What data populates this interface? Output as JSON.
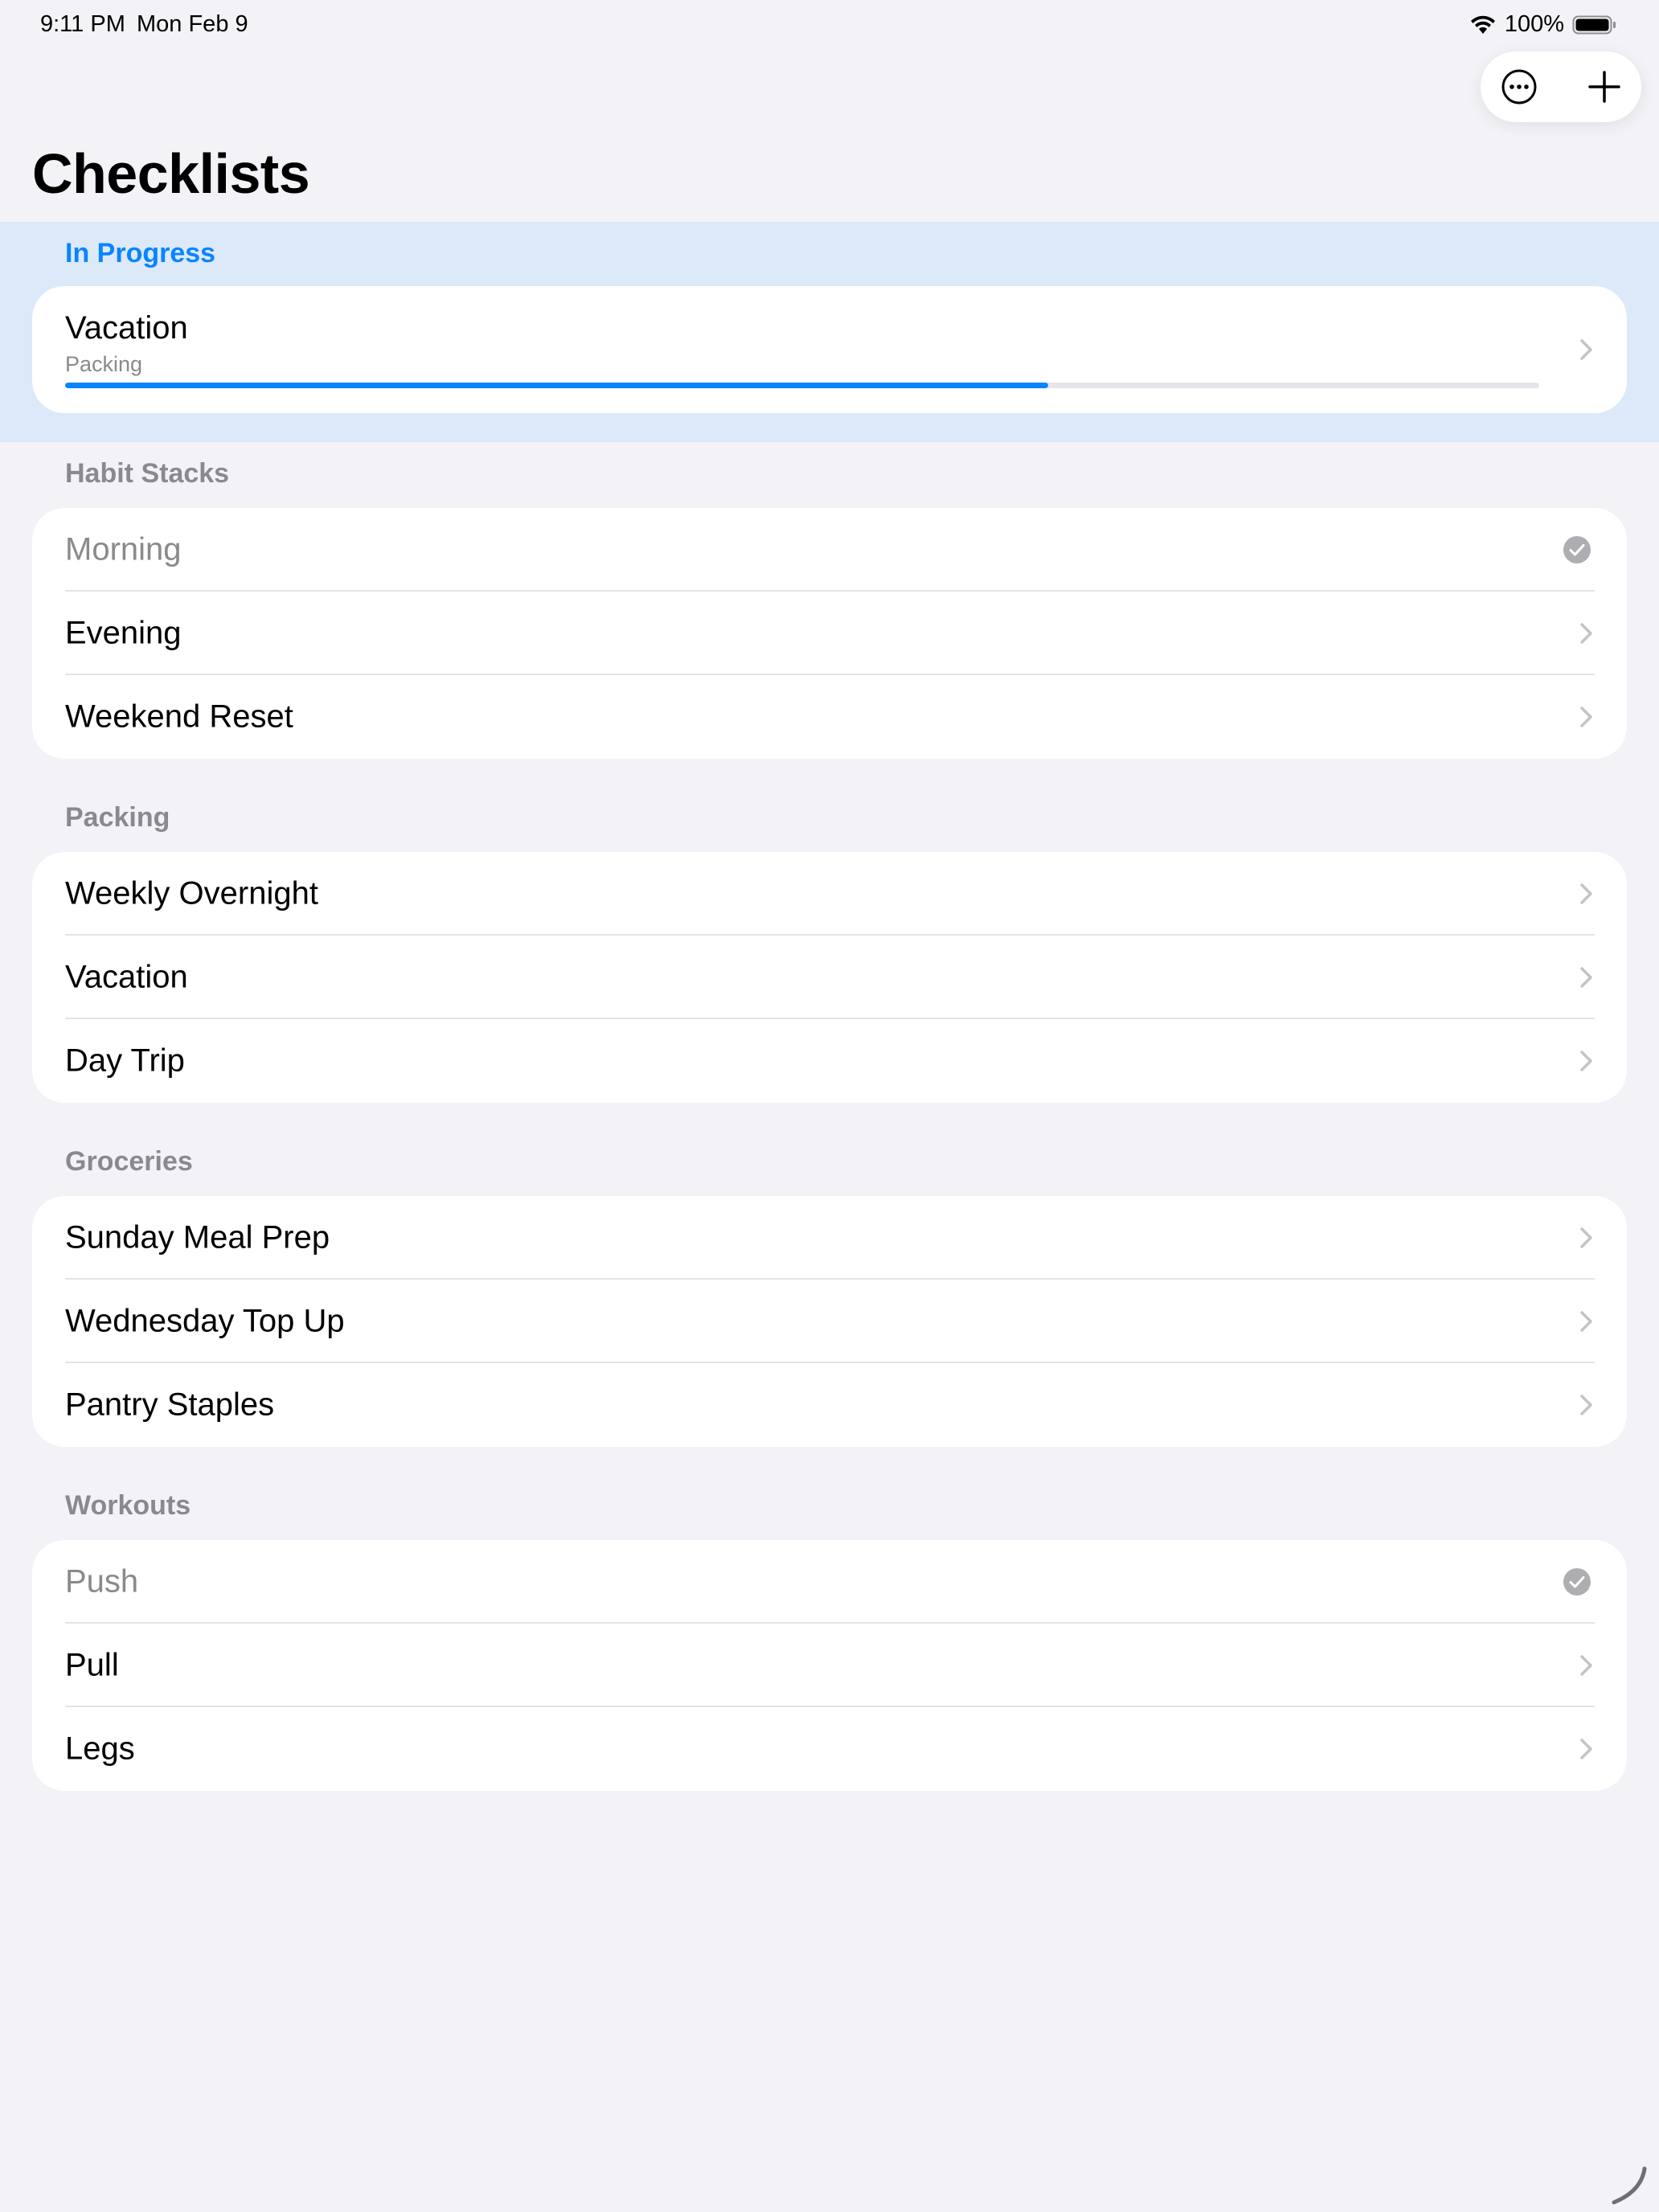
{
  "status_bar": {
    "time": "9:11 PM",
    "date": "Mon Feb 9",
    "battery": "100%"
  },
  "toolbar": {
    "more_icon": "ellipsis-circle-icon",
    "add_icon": "plus-icon"
  },
  "page": {
    "title": "Checklists"
  },
  "in_progress": {
    "header": "In Progress",
    "item": {
      "title": "Vacation",
      "subtitle": "Packing",
      "progress": 0.667
    }
  },
  "sections": [
    {
      "header": "Habit Stacks",
      "items": [
        {
          "label": "Morning",
          "done": true
        },
        {
          "label": "Evening",
          "done": false
        },
        {
          "label": "Weekend Reset",
          "done": false
        }
      ]
    },
    {
      "header": "Packing",
      "items": [
        {
          "label": "Weekly Overnight",
          "done": false
        },
        {
          "label": "Vacation",
          "done": false
        },
        {
          "label": "Day Trip",
          "done": false
        }
      ]
    },
    {
      "header": "Groceries",
      "items": [
        {
          "label": "Sunday Meal Prep",
          "done": false
        },
        {
          "label": "Wednesday Top Up",
          "done": false
        },
        {
          "label": "Pantry Staples",
          "done": false
        }
      ]
    },
    {
      "header": "Workouts",
      "items": [
        {
          "label": "Push",
          "done": true
        },
        {
          "label": "Pull",
          "done": false
        },
        {
          "label": "Legs",
          "done": false
        }
      ]
    }
  ],
  "colors": {
    "accent": "#0a84ff",
    "background": "#f2f2f7",
    "in_progress_band": "#dce9f8",
    "secondary_text": "#8a8a8e"
  }
}
